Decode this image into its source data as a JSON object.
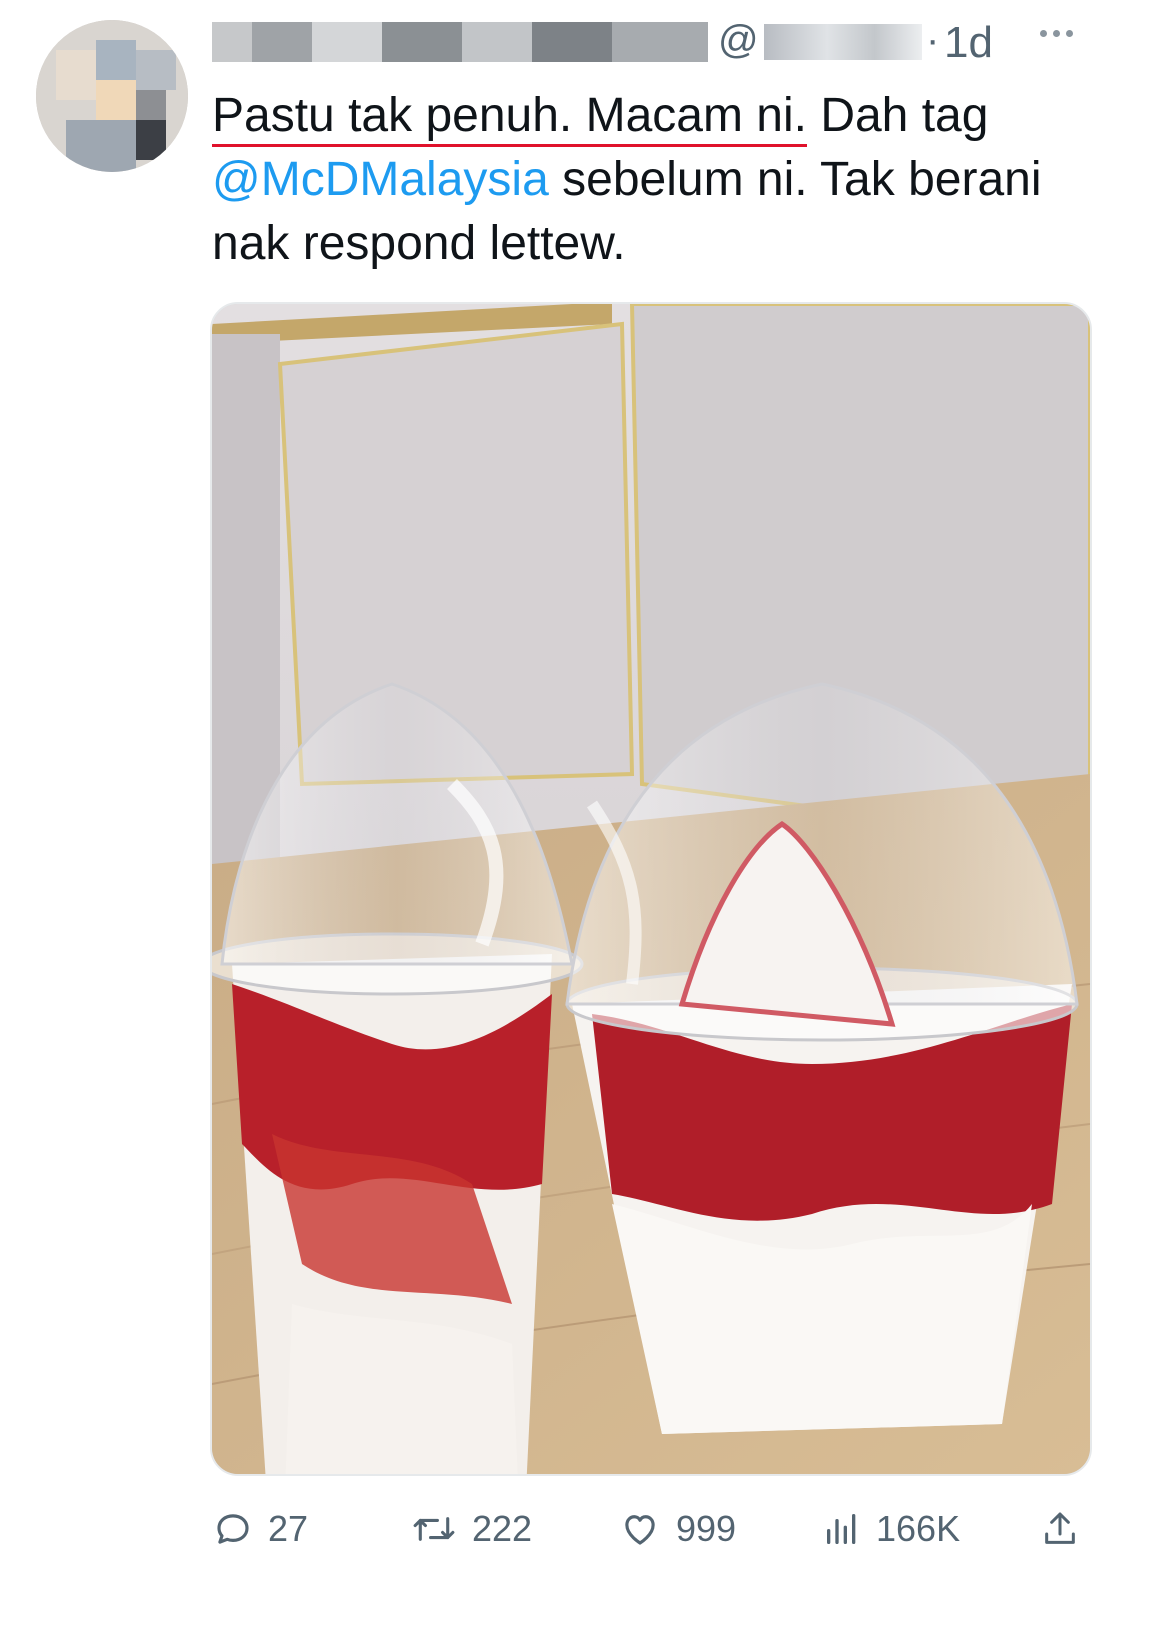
{
  "tweet": {
    "handle_prefix": "@",
    "separator": "·",
    "time": "1d",
    "text_part1": "Pastu tak penuh. Macam ni.",
    "text_part2": " Dah tag ",
    "mention": "@McDMalaysia",
    "text_part3": " sebelum ni. Tak berani nak respond lettew."
  },
  "media": {
    "alt": "Two McDonald's strawberry sundae cups with dome lids on a wooden table"
  },
  "actions": {
    "replies": "27",
    "retweets": "222",
    "likes": "999",
    "views": "166K"
  },
  "colors": {
    "accent": "#1d9bf0",
    "secondary_text": "#536471",
    "underline": "#e0112b"
  },
  "icons": [
    "reply-icon",
    "retweet-icon",
    "like-icon",
    "views-icon",
    "share-icon",
    "more-icon"
  ]
}
